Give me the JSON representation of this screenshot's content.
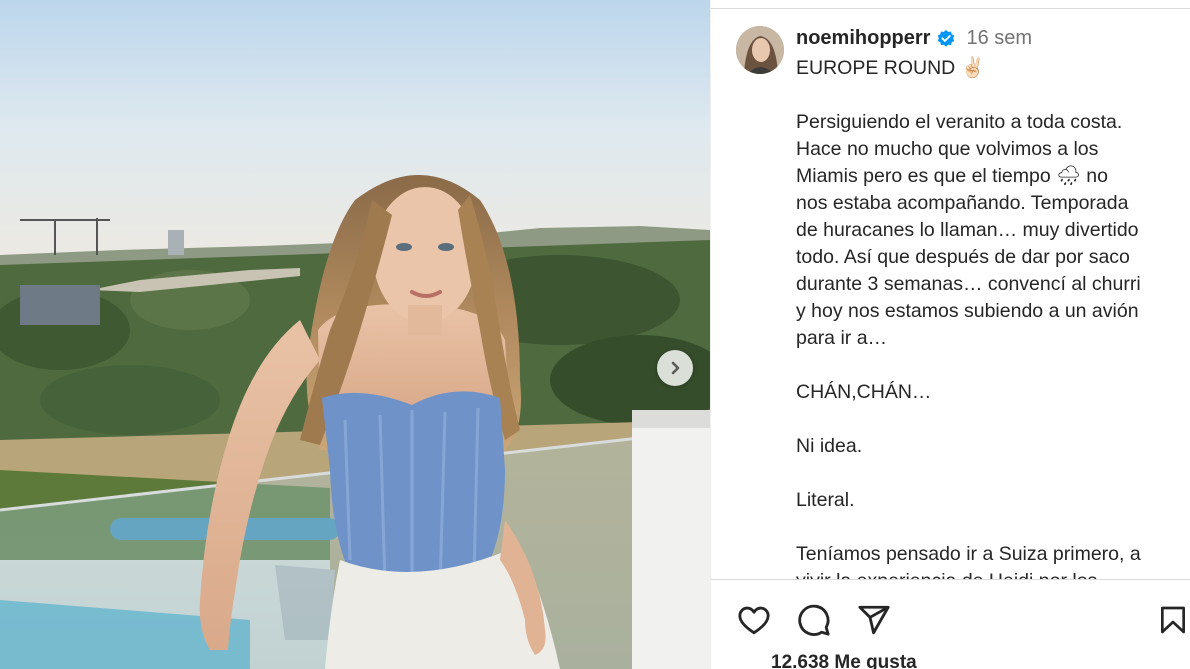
{
  "post": {
    "username": "noemihopperr",
    "timestamp": "16 sem",
    "verified": true,
    "caption": {
      "title": "EUROPE ROUND ✌🏻",
      "para1_lines": [
        "Persiguiendo el veranito a toda costa.",
        "Hace no mucho que volvimos a los",
        "Miamis pero es que el tiempo 🌧 no",
        "nos estaba acompañando. Temporada",
        "de huracanes lo llaman… muy divertido",
        "todo. Así que después de dar por saco",
        "durante 3 semanas… convencí al churri",
        "y hoy nos estamos subiendo a un avión",
        "para ir a…"
      ],
      "line2": "CHÁN,CHÁN…",
      "line3": "Ni idea.",
      "line4": "Literal.",
      "para5_lines": [
        "Teníamos pensado ir a Suiza primero, a",
        "vivir la experiencia de Heidi por los"
      ]
    },
    "likes": "12.638 Me gusta"
  },
  "icons": {
    "verified": "verified-badge-icon",
    "next": "chevron-right-icon",
    "like": "heart-icon",
    "comment": "comment-icon",
    "share": "paper-plane-icon",
    "save": "bookmark-icon"
  },
  "colors": {
    "verified_blue": "#0095f6",
    "text": "#262626",
    "secondary_text": "#737373",
    "divider": "#dbdbdb"
  }
}
